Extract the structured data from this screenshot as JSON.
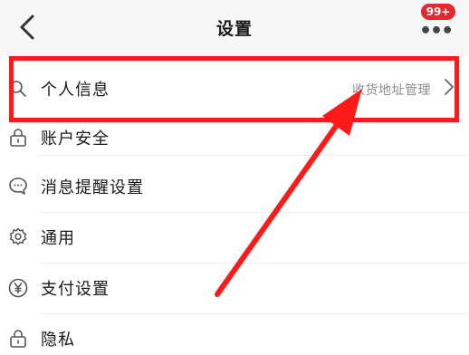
{
  "header": {
    "title": "设置",
    "back_icon": "chevron-left-icon",
    "more_icon": "more-dots-icon",
    "badge": "99+"
  },
  "list": {
    "items": [
      {
        "label": "个人信息",
        "icon": "search-icon",
        "sublabel": "收货地址管理",
        "chevron_icon": "chevron-right-icon"
      },
      {
        "label": "账户安全",
        "icon": "lock-icon"
      },
      {
        "label": "消息提醒设置",
        "icon": "chat-bubble-icon"
      },
      {
        "label": "通用",
        "icon": "gear-icon"
      },
      {
        "label": "支付设置",
        "icon": "yen-icon"
      },
      {
        "label": "隐私",
        "icon": "lock-icon"
      }
    ]
  },
  "annotation": {
    "highlight_color": "#ff1a1a",
    "arrow_color": "#ff1a1a"
  },
  "colors": {
    "badge_bg": "#e8262d",
    "header_bg": "#f7f7f7"
  }
}
